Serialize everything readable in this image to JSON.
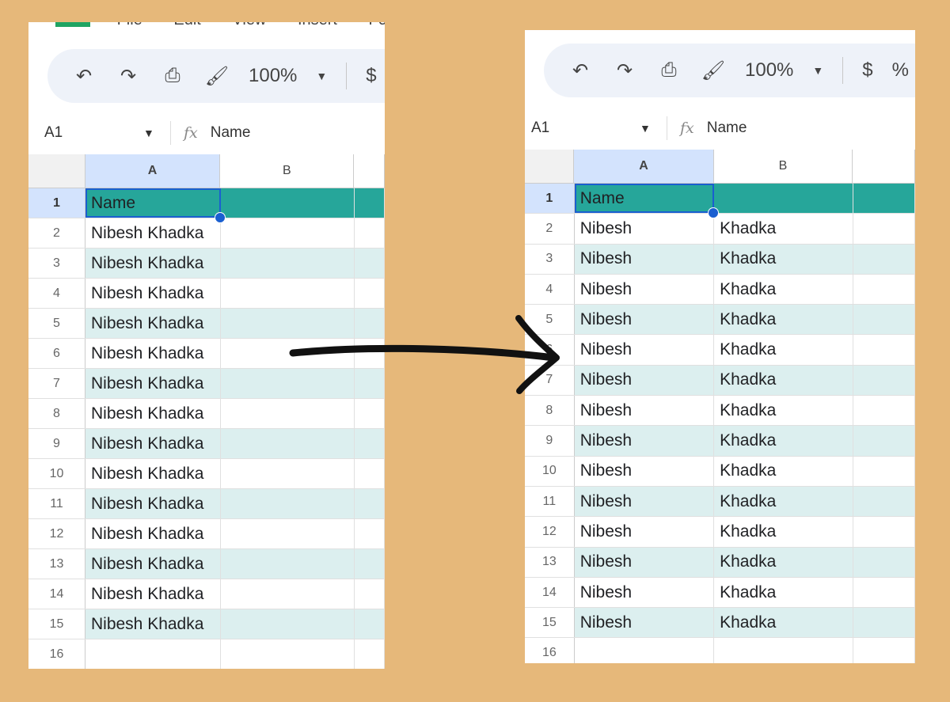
{
  "menu": [
    "File",
    "Edit",
    "View",
    "Insert",
    "Fo"
  ],
  "toolbar": {
    "zoom": "100%",
    "currency": "$",
    "percent": "%"
  },
  "formula_bar": {
    "cell_ref": "A1",
    "fx": "fx",
    "content": "Name"
  },
  "columns": [
    "A",
    "B"
  ],
  "before": {
    "header": "Name",
    "rows": [
      "Nibesh  Khadka",
      "Nibesh Khadka",
      "Nibesh Khadka",
      "Nibesh Khadka",
      "Nibesh Khadka",
      "Nibesh Khadka",
      "Nibesh Khadka",
      "Nibesh Khadka",
      "Nibesh Khadka",
      "Nibesh Khadka",
      "Nibesh Khadka",
      "Nibesh Khadka",
      "Nibesh Khadka",
      "Nibesh Khadka"
    ]
  },
  "after": {
    "header": "Name",
    "rows": [
      [
        "Nibesh",
        "Khadka"
      ],
      [
        "Nibesh",
        "Khadka"
      ],
      [
        "Nibesh",
        "Khadka"
      ],
      [
        "Nibesh",
        "Khadka"
      ],
      [
        "Nibesh",
        "Khadka"
      ],
      [
        "Nibesh",
        "Khadka"
      ],
      [
        "Nibesh",
        "Khadka"
      ],
      [
        "Nibesh",
        "Khadka"
      ],
      [
        "Nibesh",
        "Khadka"
      ],
      [
        "Nibesh",
        "Khadka"
      ],
      [
        "Nibesh",
        "Khadka"
      ],
      [
        "Nibesh",
        "Khadka"
      ],
      [
        "Nibesh",
        "Khadka"
      ],
      [
        "Nibesh",
        "Khadka"
      ]
    ]
  },
  "colors": {
    "background": "#e6b87a",
    "header_fill": "#26a69a",
    "band": "#dcefef",
    "selection": "#1a5fd0"
  }
}
